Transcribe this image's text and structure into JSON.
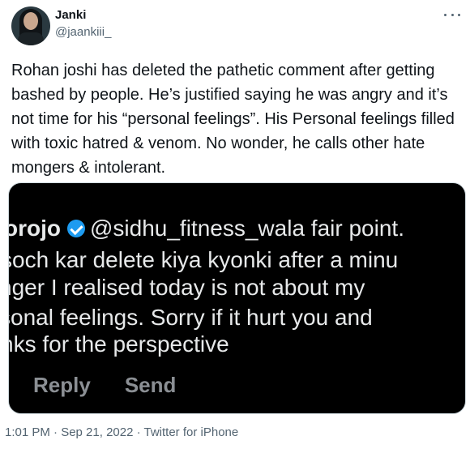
{
  "tweet": {
    "name": "Janki",
    "handle": "@jaankiii_",
    "text": "Rohan joshi has deleted the pathetic comment after getting bashed by people. He’s justified saying he was angry and it’s not time for his “personal feelings”. His Personal feelings filled with toxic hatred & venom. No wonder, he calls other hate mongers & intolerant.",
    "timestamp": "1:01 PM · Sep 21, 2022",
    "separator": " · ",
    "source": "Twitter for iPhone"
  },
  "media": {
    "username": "orojo",
    "mention": "@sidhu_fitness_wala",
    "line1_rest": " fair point.",
    "line2": "soch kar delete kiya kyonki after a minu",
    "line3": "nger I realised today is not about my",
    "line4": "sonal feelings. Sorry if it hurt you and",
    "line5": "nks for the perspective",
    "reply_label": "Reply",
    "send_label": "Send"
  },
  "icons": {
    "more": "more-options-icon",
    "verified": "verified-badge-icon"
  },
  "colors": {
    "verified_blue": "#1d9bf0",
    "meta_gray": "#536471",
    "media_bg": "#000000"
  }
}
